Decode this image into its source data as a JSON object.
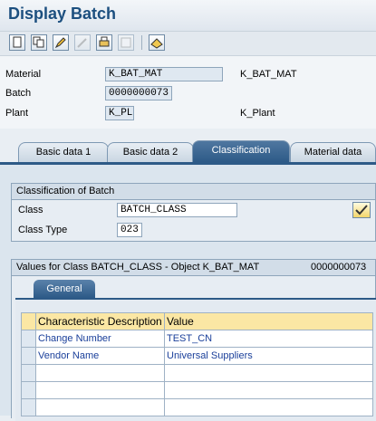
{
  "window": {
    "title": "Display Batch"
  },
  "toolbar": {
    "icons": [
      "new-document-icon",
      "copy-icon",
      "edit-pencil-icon",
      "change-icon",
      "print-icon",
      "overview-icon",
      "settings-icon"
    ]
  },
  "header": {
    "material_label": "Material",
    "material_value": "K_BAT_MAT",
    "material_desc": "K_BAT_MAT",
    "batch_label": "Batch",
    "batch_value": "0000000073",
    "plant_label": "Plant",
    "plant_value": "K_PL",
    "plant_desc": "K_Plant"
  },
  "tabs": [
    {
      "label": "Basic data 1",
      "active": false
    },
    {
      "label": "Basic data 2",
      "active": false
    },
    {
      "label": "Classification",
      "active": true
    },
    {
      "label": "Material data",
      "active": false
    }
  ],
  "classification": {
    "group_title": "Classification of Batch",
    "class_label": "Class",
    "class_value": "BATCH_CLASS",
    "class_type_label": "Class Type",
    "class_type_value": "023"
  },
  "values_section": {
    "title": "Values for Class BATCH_CLASS - Object K_BAT_MAT",
    "object_no": "0000000073",
    "inner_tab": "General",
    "columns": [
      "Characteristic Description",
      "Value"
    ],
    "rows": [
      {
        "desc": "Change Number",
        "value": "TEST_CN"
      },
      {
        "desc": "Vendor Name",
        "value": "Universal Suppliers"
      }
    ]
  }
}
